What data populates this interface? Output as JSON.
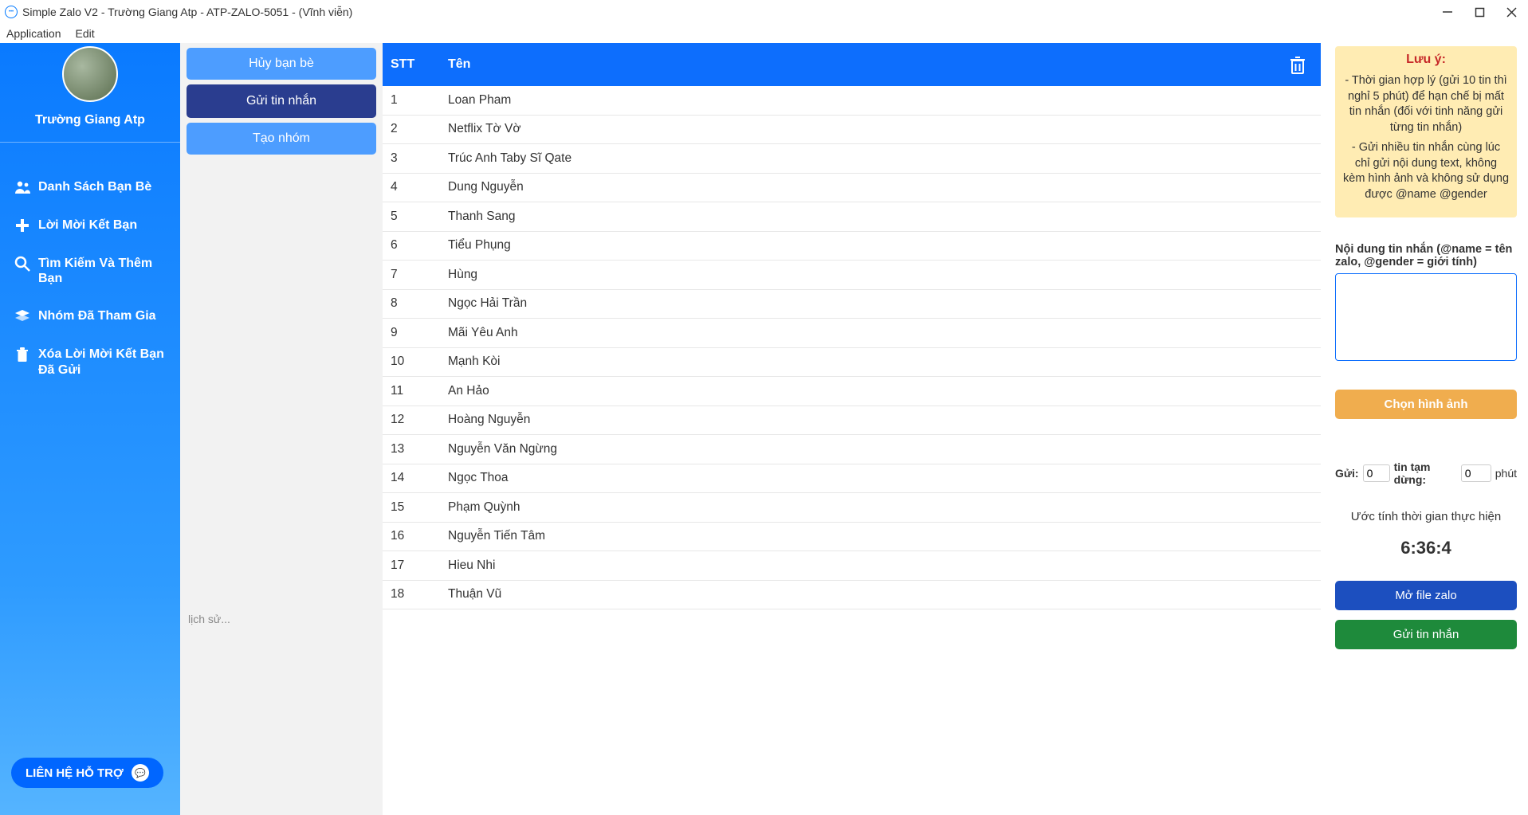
{
  "window": {
    "title": "Simple Zalo V2  - Trường Giang Atp - ATP-ZALO-5051        - (Vĩnh viễn)"
  },
  "menubar": {
    "application": "Application",
    "edit": "Edit"
  },
  "sidebar": {
    "username": "Trường Giang Atp",
    "items": [
      "Danh Sách Bạn Bè",
      "Lời Mời Kết Bạn",
      "Tìm Kiếm Và Thêm Bạn",
      "Nhóm Đã Tham Gia",
      "Xóa Lời Mời Kết Bạn Đã Gửi"
    ],
    "support": "LIÊN HỆ HỖ TRỢ"
  },
  "col2": {
    "cancel_friend": "Hủy bạn bè",
    "send_msg": "Gửi tin nhắn",
    "create_group": "Tạo nhóm",
    "history_placeholder": "lịch sử..."
  },
  "table": {
    "head_stt": "STT",
    "head_name": "Tên",
    "rows": [
      {
        "stt": "1",
        "name": "Loan Pham"
      },
      {
        "stt": "2",
        "name": "Netflix Tờ Vờ"
      },
      {
        "stt": "3",
        "name": "Trúc Anh Taby Sĩ Qate"
      },
      {
        "stt": "4",
        "name": "Dung Nguyễn"
      },
      {
        "stt": "5",
        "name": "Thanh Sang"
      },
      {
        "stt": "6",
        "name": "Tiểu Phụng"
      },
      {
        "stt": "7",
        "name": "Hùng"
      },
      {
        "stt": "8",
        "name": "Ngọc Hải Trần"
      },
      {
        "stt": "9",
        "name": "Mãi Yêu Anh"
      },
      {
        "stt": "10",
        "name": "Mạnh Kòi"
      },
      {
        "stt": "11",
        "name": "An Hảo"
      },
      {
        "stt": "12",
        "name": "Hoàng Nguyễn"
      },
      {
        "stt": "13",
        "name": "Nguyễn Văn Ngừng"
      },
      {
        "stt": "14",
        "name": "Ngọc Thoa"
      },
      {
        "stt": "15",
        "name": "Phạm Quỳnh"
      },
      {
        "stt": "16",
        "name": "Nguyễn Tiến Tâm"
      },
      {
        "stt": "17",
        "name": "Hieu Nhi"
      },
      {
        "stt": "18",
        "name": "Thuận Vũ"
      }
    ]
  },
  "right": {
    "notice_title": "Lưu ý:",
    "notice_p1": "- Thời gian hợp lý (gửi 10 tin thì nghỉ 5 phút) để hạn chế bị mất tin nhắn (đối với tinh năng gửi từng tin nhắn)",
    "notice_p2": "- Gửi nhiều tin nhắn cùng lúc chỉ gửi nội dung text, không kèm hình ảnh và không sử dụng được @name @gender",
    "msg_label": "Nội dung tin nhắn (@name = tên zalo, @gender = giới tính)",
    "choose_img": "Chọn hình ảnh",
    "send_label": "Gửi:",
    "send_val": "0",
    "pause_label": "tin tạm dừng:",
    "pause_val": "0",
    "minute": "phút",
    "est_label": "Ước tính thời gian thực hiện",
    "est_time": "6:36:4",
    "open_file": "Mở file zalo",
    "send_btn": "Gửi tin nhắn"
  }
}
